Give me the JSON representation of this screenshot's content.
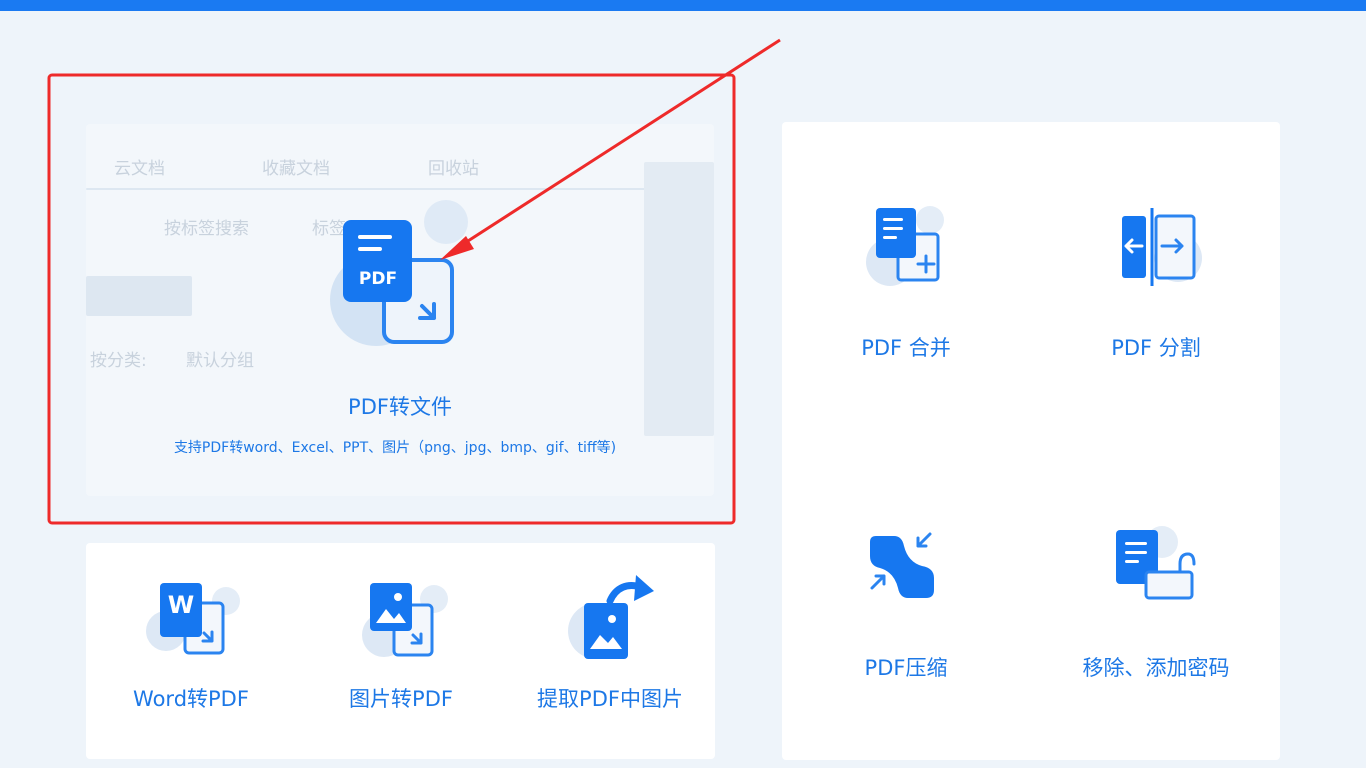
{
  "colors": {
    "accent": "#1a7af2",
    "icon_blue": "#1677f0",
    "highlight": "#ee2a2a",
    "text_blue": "#1d78e6"
  },
  "background_ghost": {
    "tabs": [
      "云文档",
      "收藏文档",
      "回收站"
    ],
    "row1": [
      "按标签搜索",
      "标签"
    ],
    "filter_label": "按分类:",
    "filter_value": "默认分组"
  },
  "main_tool": {
    "icon": "pdf-to-file-icon",
    "icon_text": "PDF",
    "title": "PDF转文件",
    "description": "支持PDF转word、Excel、PPT、图片（png、jpg、bmp、gif、tiff等)"
  },
  "bottom_tools": [
    {
      "icon": "word-to-pdf-icon",
      "icon_text": "W",
      "label": "Word转PDF"
    },
    {
      "icon": "image-to-pdf-icon",
      "label": "图片转PDF"
    },
    {
      "icon": "extract-images-icon",
      "label": "提取PDF中图片"
    }
  ],
  "right_tools": [
    {
      "icon": "pdf-merge-icon",
      "label": "PDF 合并"
    },
    {
      "icon": "pdf-split-icon",
      "label": "PDF 分割"
    },
    {
      "icon": "pdf-compress-icon",
      "label": "PDF压缩"
    },
    {
      "icon": "password-lock-icon",
      "label": "移除、添加密码"
    }
  ]
}
